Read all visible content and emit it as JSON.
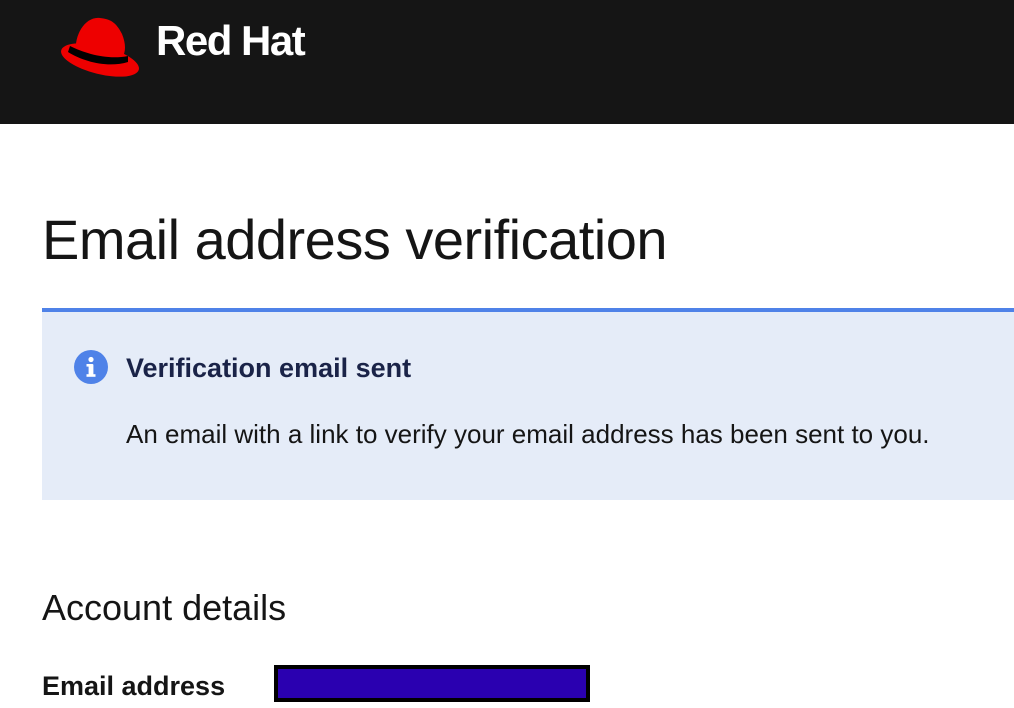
{
  "header": {
    "brand_name": "Red Hat",
    "brand_logo_icon": "red-fedora-hat-icon",
    "background_color": "#151515",
    "hat_color": "#ee0000"
  },
  "page": {
    "title": "Email address verification"
  },
  "alert": {
    "variant": "info",
    "icon": "info-circle-icon",
    "accent_color": "#4f82e8",
    "background_color": "#e5ecf8",
    "title": "Verification email sent",
    "body": "An email with a link to verify your email address has been sent to you."
  },
  "account_details": {
    "heading": "Account details",
    "email_label": "Email address",
    "email_value_redacted": true,
    "redaction_color": "#2a00b0"
  }
}
